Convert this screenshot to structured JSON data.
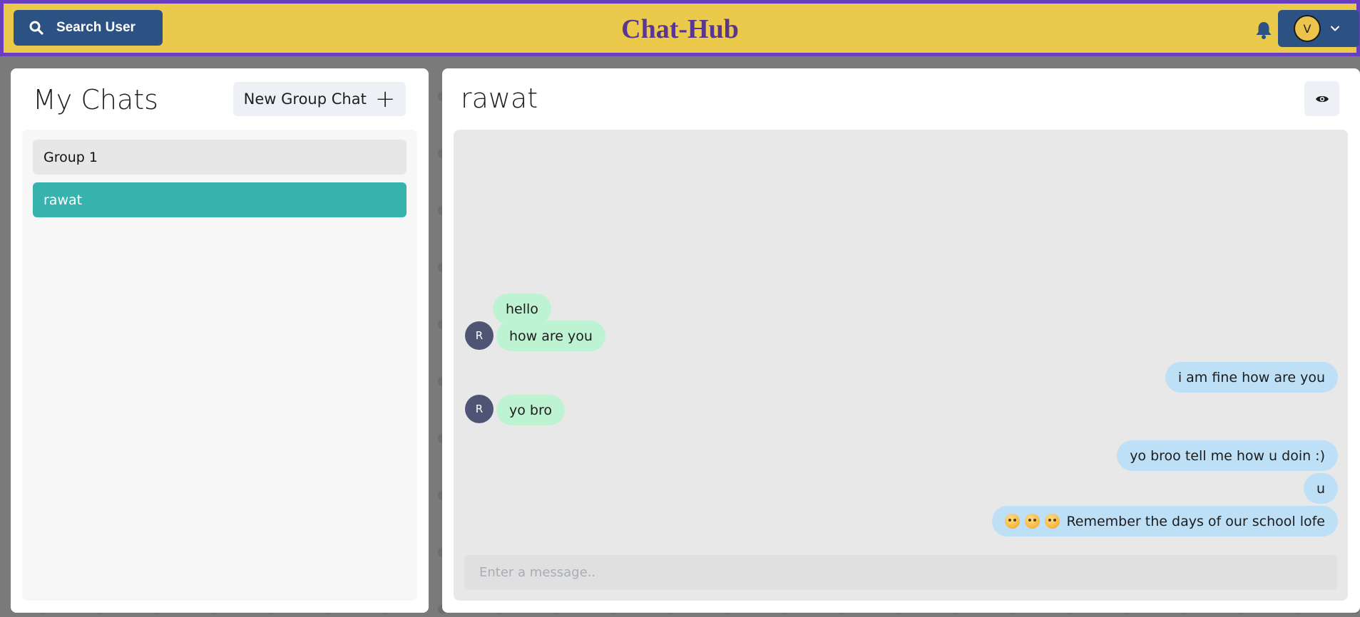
{
  "header": {
    "search_label": "Search User",
    "brand": "Chat-Hub",
    "profile_initial": "V"
  },
  "chats_panel": {
    "title": "My Chats",
    "new_group_label": "New Group Chat",
    "new_group_icon": "+",
    "items": [
      {
        "name": "Group 1",
        "selected": false
      },
      {
        "name": "rawat",
        "selected": true
      }
    ]
  },
  "conversation": {
    "title": "rawat",
    "messages": [
      {
        "text": "hello",
        "direction": "incoming",
        "avatar": ""
      },
      {
        "text": "how are you",
        "direction": "incoming",
        "avatar": "R"
      },
      {
        "text": "i am fine how are you",
        "direction": "outgoing",
        "avatar": ""
      },
      {
        "text": "yo bro",
        "direction": "incoming",
        "avatar": "R"
      },
      {
        "text": "yo broo tell me how u doin :)",
        "direction": "outgoing",
        "avatar": ""
      },
      {
        "text": "u",
        "direction": "outgoing",
        "avatar": ""
      },
      {
        "text": "Remember the days of our school lofe",
        "direction": "outgoing",
        "avatar": "",
        "emoji_prefix_count": 3
      }
    ],
    "input_placeholder": "Enter a message.."
  },
  "colors": {
    "topbar_bg": "#ebc94a",
    "topbar_border": "#6a3fbf",
    "brand_text": "#5b3592",
    "button_blue": "#2b5283",
    "active_chat": "#38b2ac",
    "incoming_bubble": "#bdf3d2",
    "outgoing_bubble": "#bde0f7",
    "sender_avatar": "#4f5475"
  }
}
